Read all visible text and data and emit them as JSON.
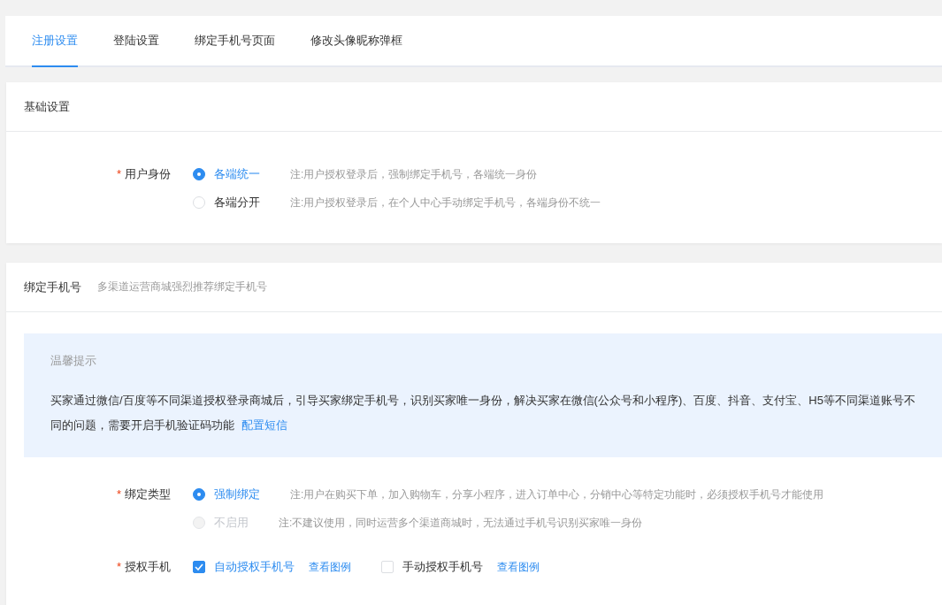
{
  "tabs": [
    {
      "label": "注册设置",
      "selected": true
    },
    {
      "label": "登陆设置",
      "selected": false
    },
    {
      "label": "绑定手机号页面",
      "selected": false
    },
    {
      "label": "修改头像昵称弹框",
      "selected": false
    }
  ],
  "sections": [
    {
      "title": "基础设置",
      "fields": [
        {
          "label": "用户身份",
          "required_mark": "*",
          "kind": "radio",
          "options": [
            {
              "label": "各端统一",
              "selected": true,
              "disabled": false,
              "note": "注:用户授权登录后，强制绑定手机号，各端统一身份"
            },
            {
              "label": "各端分开",
              "selected": false,
              "disabled": false,
              "note": "注:用户授权登录后，在个人中心手动绑定手机号，各端身份不统一"
            }
          ]
        }
      ]
    },
    {
      "title": "绑定手机号",
      "subtitle": "多渠道运营商城强烈推荐绑定手机号",
      "tip": {
        "title": "温馨提示",
        "text": "买家通过微信/百度等不同渠道授权登录商城后，引导买家绑定手机号，识别买家唯一身份，解决买家在微信(公众号和小程序)、百度、抖音、支付宝、H5等不同渠道账号不同的问题，需要开启手机验证码功能",
        "link": "配置短信"
      },
      "fields": [
        {
          "label": "绑定类型",
          "required_mark": "*",
          "kind": "radio",
          "options": [
            {
              "label": "强制绑定",
              "selected": true,
              "disabled": false,
              "note": "注:用户在购买下单，加入购物车，分享小程序，进入订单中心，分销中心等特定功能时，必须授权手机号才能使用"
            },
            {
              "label": "不启用",
              "selected": false,
              "disabled": true,
              "note": "注:不建议使用，同时运营多个渠道商城时，无法通过手机号识别买家唯一身份"
            }
          ]
        },
        {
          "label": "授权手机",
          "required_mark": "*",
          "kind": "checkbox",
          "options": [
            {
              "label": "自动授权手机号",
              "checked": true,
              "link": "查看图例"
            },
            {
              "label": "手动授权手机号",
              "checked": false,
              "link": "查看图例"
            }
          ]
        }
      ]
    }
  ]
}
